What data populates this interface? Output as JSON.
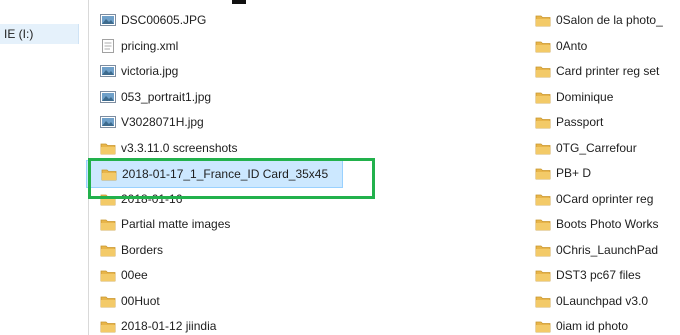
{
  "nav": {
    "drive_label": "IE (I:)"
  },
  "files_left": [
    {
      "name": "DSC00605.JPG",
      "icon": "image-file-icon"
    },
    {
      "name": "pricing.xml",
      "icon": "xml-file-icon"
    },
    {
      "name": "victoria.jpg",
      "icon": "image-file-icon"
    },
    {
      "name": "053_portrait1.jpg",
      "icon": "image-file-icon"
    },
    {
      "name": "V3028071H.jpg",
      "icon": "image-file-icon"
    },
    {
      "name": "v3.3.11.0 screenshots",
      "icon": "folder-icon"
    },
    {
      "name": "2018-01-17_1_France_ID Card_35x45",
      "icon": "folder-icon",
      "selected": true
    },
    {
      "name": "2018-01-16",
      "icon": "folder-icon"
    },
    {
      "name": "Partial matte images",
      "icon": "folder-icon"
    },
    {
      "name": "Borders",
      "icon": "folder-icon"
    },
    {
      "name": "00ee",
      "icon": "folder-icon"
    },
    {
      "name": "00Huot",
      "icon": "folder-icon"
    },
    {
      "name": "2018-01-12 jiindia",
      "icon": "folder-icon"
    }
  ],
  "files_right": [
    {
      "name": "0Salon de la photo_",
      "icon": "folder-icon"
    },
    {
      "name": "0Anto",
      "icon": "folder-icon"
    },
    {
      "name": "Card printer reg set",
      "icon": "folder-icon"
    },
    {
      "name": "Dominique",
      "icon": "folder-icon"
    },
    {
      "name": "Passport",
      "icon": "folder-icon"
    },
    {
      "name": "0TG_Carrefour",
      "icon": "folder-icon"
    },
    {
      "name": "PB+ D",
      "icon": "folder-icon"
    },
    {
      "name": "0Card oprinter reg",
      "icon": "folder-icon"
    },
    {
      "name": "Boots Photo Works",
      "icon": "folder-icon"
    },
    {
      "name": "0Chris_LaunchPad",
      "icon": "folder-icon"
    },
    {
      "name": "DST3 pc67 files",
      "icon": "folder-icon"
    },
    {
      "name": "0Launchpad v3.0",
      "icon": "folder-icon"
    },
    {
      "name": "0iam id photo",
      "icon": "folder-icon"
    }
  ],
  "colors": {
    "selection_bg": "#cce8ff",
    "selection_border": "#99d1ff",
    "highlight_box": "#22b14c",
    "folder": "#e8b54a"
  }
}
